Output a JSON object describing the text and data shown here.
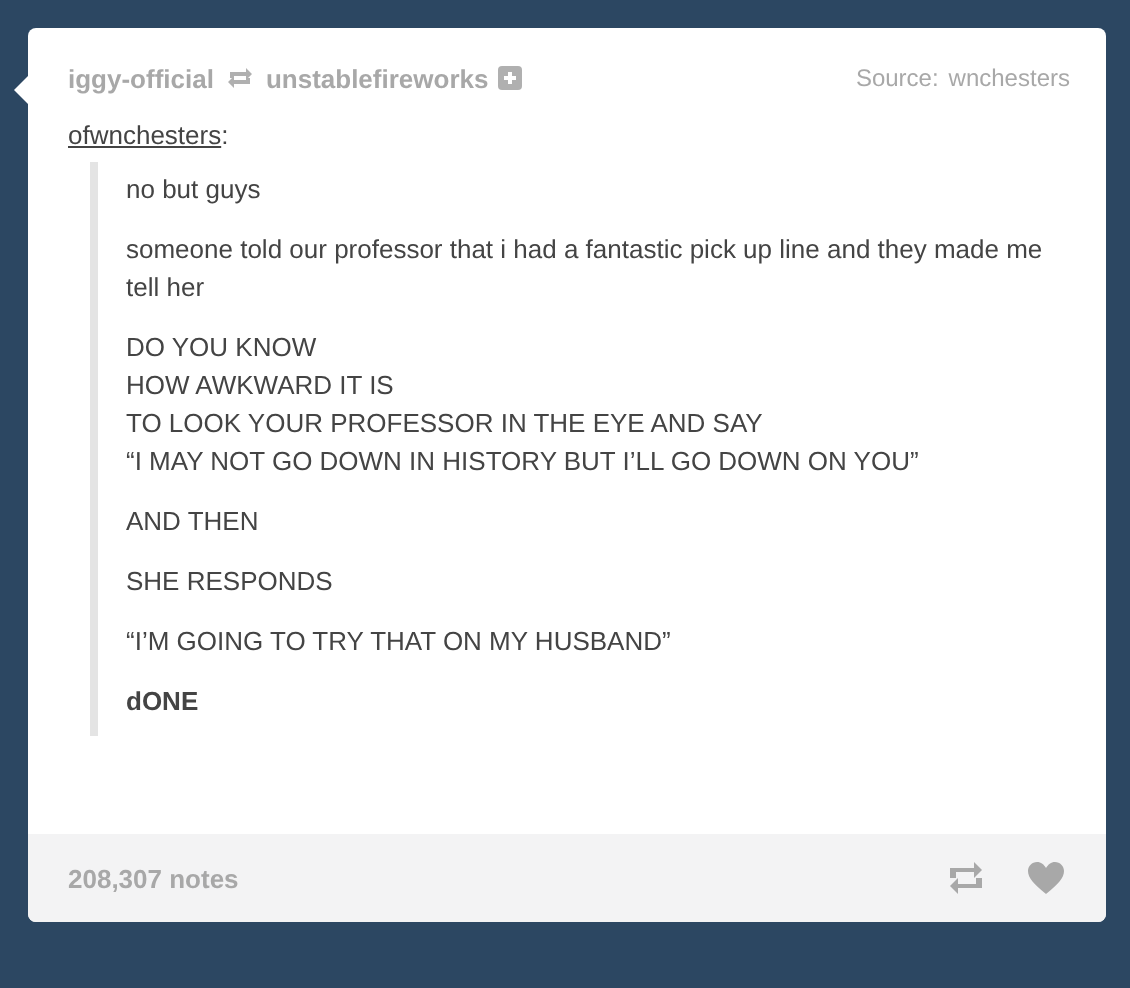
{
  "post": {
    "blog": "iggy-official",
    "reblogged_from": "unstablefireworks",
    "source_label": "Source:",
    "source": "wnchesters",
    "quote_author": "ofwnchesters",
    "quote_colon": ":",
    "paragraphs": [
      {
        "lines": [
          "no but guys"
        ],
        "bold": false
      },
      {
        "lines": [
          "someone told our professor that i had a fantastic pick up line and they made me tell her"
        ],
        "bold": false
      },
      {
        "lines": [
          "DO YOU KNOW",
          "HOW AWKWARD IT IS",
          "TO LOOK YOUR PROFESSOR IN THE EYE AND SAY",
          "“I MAY NOT GO DOWN IN HISTORY BUT I’LL GO DOWN ON YOU”"
        ],
        "bold": false
      },
      {
        "lines": [
          "AND THEN"
        ],
        "bold": false
      },
      {
        "lines": [
          "SHE RESPONDS"
        ],
        "bold": false
      },
      {
        "lines": [
          "“I’M GOING TO TRY THAT ON MY HUSBAND”"
        ],
        "bold": false
      },
      {
        "lines": [
          "dONE"
        ],
        "bold": true
      }
    ],
    "notes": "208,307 notes"
  }
}
